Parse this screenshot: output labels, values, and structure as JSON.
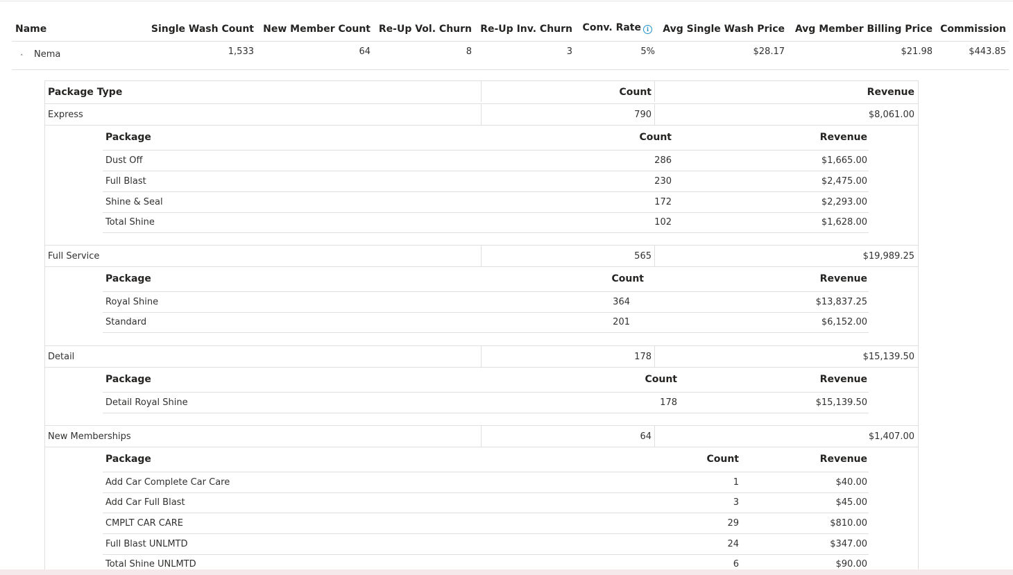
{
  "main_table": {
    "headers": {
      "name": "Name",
      "single_wash_count": "Single Wash Count",
      "new_member_count": "New Member Count",
      "reup_vol_churn": "Re-Up Vol. Churn",
      "reup_inv_churn": "Re-Up Inv. Churn",
      "conv_rate": "Conv. Rate",
      "avg_single_wash_price": "Avg Single Wash Price",
      "avg_member_billing_price": "Avg Member Billing Price",
      "commission": "Commission"
    },
    "row": {
      "name": "Nema",
      "single_wash_count": "1,533",
      "new_member_count": "64",
      "reup_vol_churn": "8",
      "reup_inv_churn": "3",
      "conv_rate": "5%",
      "avg_single_wash_price": "$28.17",
      "avg_member_billing_price": "$21.98",
      "commission": "$443.85"
    }
  },
  "package_types": {
    "headers": {
      "type": "Package Type",
      "count": "Count",
      "revenue": "Revenue"
    },
    "inner_headers": {
      "package": "Package",
      "count": "Count",
      "revenue": "Revenue"
    },
    "groups": [
      {
        "type": "Express",
        "count": "790",
        "revenue": "$8,061.00",
        "packages": [
          {
            "name": "Dust Off",
            "count": "286",
            "revenue": "$1,665.00"
          },
          {
            "name": "Full Blast",
            "count": "230",
            "revenue": "$2,475.00"
          },
          {
            "name": "Shine & Seal",
            "count": "172",
            "revenue": "$2,293.00"
          },
          {
            "name": "Total Shine",
            "count": "102",
            "revenue": "$1,628.00"
          }
        ]
      },
      {
        "type": "Full Service",
        "count": "565",
        "revenue": "$19,989.25",
        "packages": [
          {
            "name": "Royal Shine",
            "count": "364",
            "revenue": "$13,837.25"
          },
          {
            "name": "Standard",
            "count": "201",
            "revenue": "$6,152.00"
          }
        ]
      },
      {
        "type": "Detail",
        "count": "178",
        "revenue": "$15,139.50",
        "packages": [
          {
            "name": "Detail Royal Shine",
            "count": "178",
            "revenue": "$15,139.50"
          }
        ]
      },
      {
        "type": "New Memberships",
        "count": "64",
        "revenue": "$1,407.00",
        "packages": [
          {
            "name": "Add Car Complete Car Care",
            "count": "1",
            "revenue": "$40.00"
          },
          {
            "name": "Add Car Full Blast",
            "count": "3",
            "revenue": "$45.00"
          },
          {
            "name": "CMPLT CAR CARE",
            "count": "29",
            "revenue": "$810.00"
          },
          {
            "name": "Full Blast UNLMTD",
            "count": "24",
            "revenue": "$347.00"
          },
          {
            "name": "Total Shine UNLMTD",
            "count": "6",
            "revenue": "$90.00"
          }
        ]
      }
    ]
  },
  "icons": {
    "info": "info-icon",
    "collapse": "chevron-up-icon"
  },
  "colors": {
    "info_accent": "#1f8ec7",
    "border": "#e1dfdd"
  }
}
